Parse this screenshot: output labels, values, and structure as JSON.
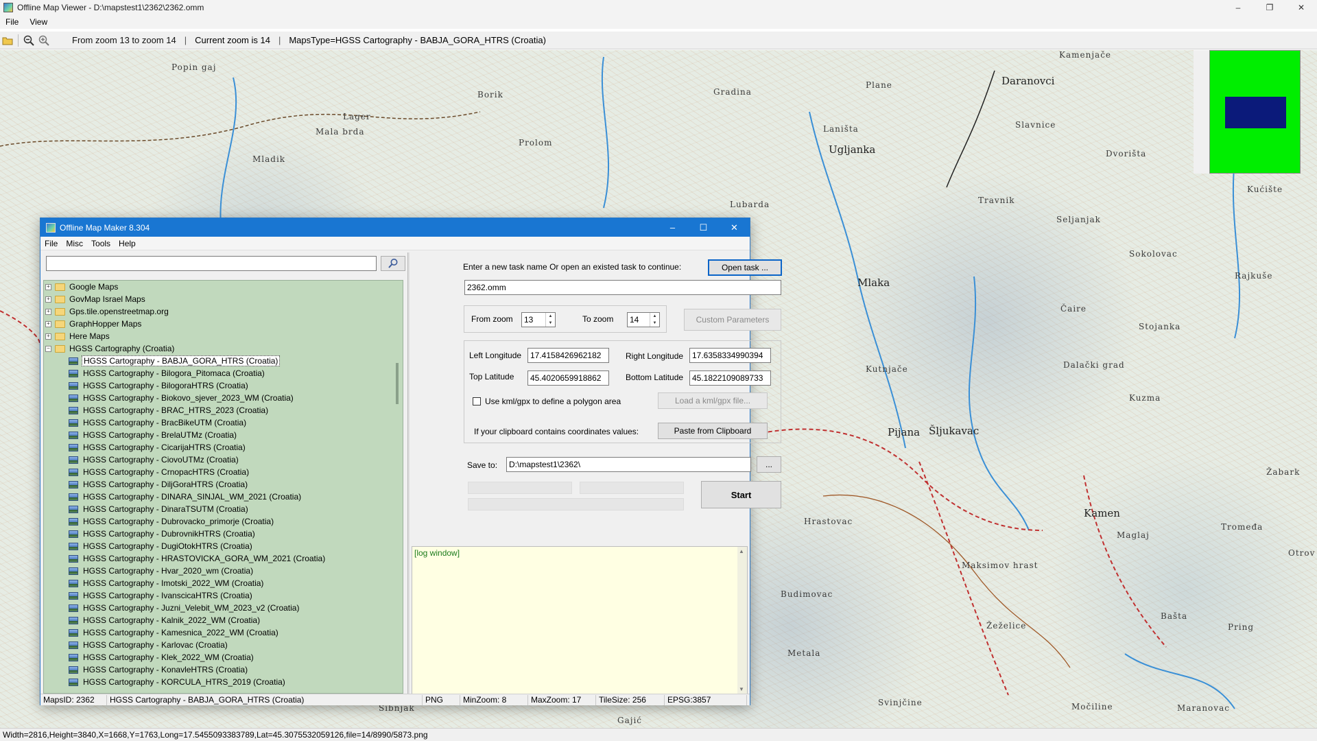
{
  "outer": {
    "title": "Offline Map Viewer - D:\\mapstest1\\2362\\2362.omm",
    "menu": [
      "File",
      "View"
    ],
    "toolbar": {
      "zoom_range": "From zoom 13 to zoom 14",
      "current_zoom": "Current zoom is 14",
      "maps_type": "MapsType=HGSS Cartography - BABJA_GORA_HTRS (Croatia)"
    },
    "status": "Width=2816,Height=3840,X=1668,Y=1763,Long=17.5455093383789,Lat=45.3075532059126,file=14/8990/5873.png"
  },
  "map": {
    "places": [
      "Popin gaj",
      "Mladik",
      "Lager",
      "Mala brda",
      "Borik",
      "Prolom",
      "Gradina",
      "Plane",
      "Daranovci",
      "Kamenjače",
      "Laništa",
      "Slavnice",
      "Dvorišta",
      "Ugljanka",
      "Lubarda",
      "Travnik",
      "Seljanjak",
      "Sokolovac",
      "Rajkuše",
      "Mlaka",
      "Čaire",
      "Stojanka",
      "Kutnjače",
      "Dalački grad",
      "Kuzma",
      "Pijana",
      "Šljukavac",
      "Hrastovac",
      "Kamen",
      "Maglaj",
      "Tromeđa",
      "Maksimov hrast",
      "Budimovac",
      "Metala",
      "Žeželice",
      "Bašta",
      "Otrov",
      "Svinjčine",
      "Močiline",
      "Maranovac",
      "Žabark",
      "Pring",
      "Kućište",
      "Gajić",
      "Sibnjak"
    ]
  },
  "dialog": {
    "title": "Offline Map Maker 8.304",
    "menu": [
      "File",
      "Misc",
      "Tools",
      "Help"
    ],
    "search_value": "",
    "tree": {
      "folders": [
        {
          "label": "Google Maps",
          "expander": "+"
        },
        {
          "label": "GovMap Israel Maps",
          "expander": "+"
        },
        {
          "label": "Gps.tile.openstreetmap.org",
          "expander": "+"
        },
        {
          "label": "GraphHopper Maps",
          "expander": "+"
        },
        {
          "label": "Here Maps",
          "expander": "+"
        },
        {
          "label": "HGSS Cartography (Croatia)",
          "expander": "−"
        }
      ],
      "children": [
        "HGSS Cartography - BABJA_GORA_HTRS (Croatia)",
        "HGSS Cartography - Bilogora_Pitomaca (Croatia)",
        "HGSS Cartography - BilogoraHTRS (Croatia)",
        "HGSS Cartography - Biokovo_sjever_2023_WM (Croatia)",
        "HGSS Cartography - BRAC_HTRS_2023 (Croatia)",
        "HGSS Cartography - BracBikeUTM (Croatia)",
        "HGSS Cartography - BrelaUTMz (Croatia)",
        "HGSS Cartography - CicarijaHTRS (Croatia)",
        "HGSS Cartography - CiovoUTMz (Croatia)",
        "HGSS Cartography - CrnopacHTRS (Croatia)",
        "HGSS Cartography - DiljGoraHTRS (Croatia)",
        "HGSS Cartography - DINARA_SINJAL_WM_2021 (Croatia)",
        "HGSS Cartography - DinaraTSUTM (Croatia)",
        "HGSS Cartography - Dubrovacko_primorje (Croatia)",
        "HGSS Cartography - DubrovnikHTRS (Croatia)",
        "HGSS Cartography - DugiOtokHTRS (Croatia)",
        "HGSS Cartography - HRASTOVICKA_GORA_WM_2021 (Croatia)",
        "HGSS Cartography - Hvar_2020_wm (Croatia)",
        "HGSS Cartography - Imotski_2022_WM (Croatia)",
        "HGSS Cartography - IvanscicaHTRS (Croatia)",
        "HGSS Cartography - Juzni_Velebit_WM_2023_v2 (Croatia)",
        "HGSS Cartography - Kalnik_2022_WM (Croatia)",
        "HGSS Cartography - Kamesnica_2022_WM (Croatia)",
        "HGSS Cartography - Karlovac (Croatia)",
        "HGSS Cartography - Klek_2022_WM (Croatia)",
        "HGSS Cartography - KonavleHTRS (Croatia)",
        "HGSS Cartography - KORCULA_HTRS_2019 (Croatia)"
      ]
    },
    "task": {
      "prompt": "Enter a new task name Or open an existed task to continue:",
      "open_button": "Open task ...",
      "name": "2362.omm"
    },
    "zoom": {
      "from_label": "From zoom",
      "from_value": "13",
      "to_label": "To zoom",
      "to_value": "14",
      "custom_button": "Custom Parameters"
    },
    "coords": {
      "left_lon_label": "Left Longitude",
      "left_lon": "17.4158426962182",
      "right_lon_label": "Right Longitude",
      "right_lon": "17.6358334990394",
      "top_lat_label": "Top Latitude",
      "top_lat": "45.4020659918862",
      "bottom_lat_label": "Bottom Latitude",
      "bottom_lat": "45.1822109089733",
      "kml_checkbox_label": "Use kml/gpx to define a polygon area",
      "kml_button": "Load a kml/gpx file...",
      "clipboard_label": "If your clipboard contains coordinates values:",
      "clipboard_button": "Paste from Clipboard"
    },
    "save": {
      "label": "Save to:",
      "path": "D:\\mapstest1\\2362\\",
      "browse": "..."
    },
    "start_button": "Start",
    "log": "[log window]",
    "status": {
      "maps_id": "MapsID: 2362",
      "maps_name": "HGSS Cartography - BABJA_GORA_HTRS (Croatia)",
      "format": "PNG",
      "min_zoom": "MinZoom: 8",
      "max_zoom": "MaxZoom: 17",
      "tile_size": "TileSize: 256",
      "epsg": "EPSG:3857"
    }
  }
}
